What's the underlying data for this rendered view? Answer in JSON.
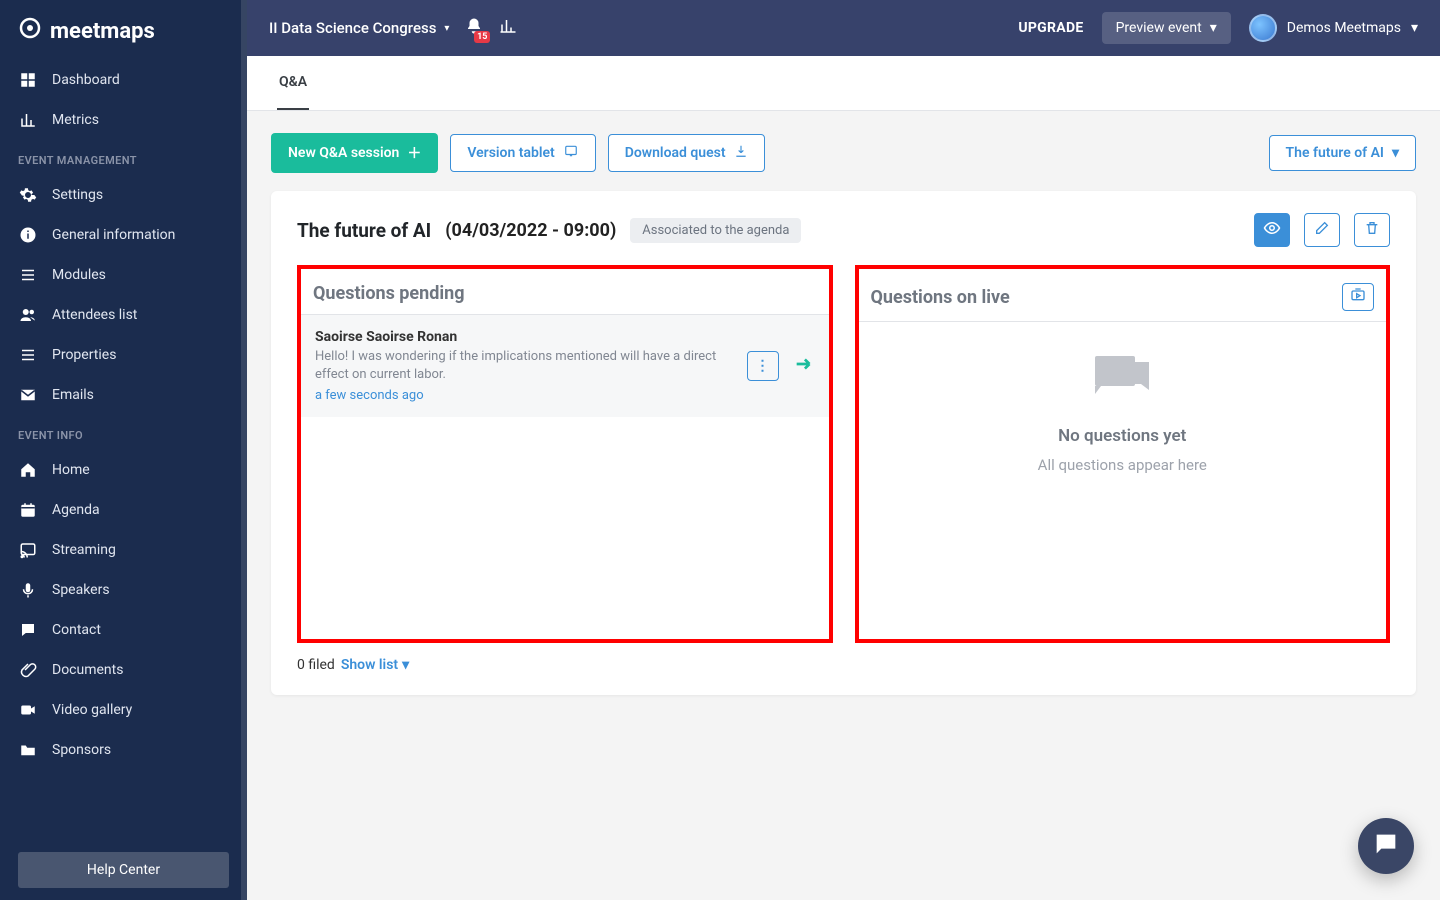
{
  "brand": "meetmaps",
  "topbar": {
    "event_name": "II Data Science Congress",
    "notif_count": "15",
    "upgrade": "UPGRADE",
    "preview": "Preview event",
    "user_name": "Demos Meetmaps"
  },
  "sidebar": {
    "top": [
      {
        "icon": "dashboard",
        "label": "Dashboard"
      },
      {
        "icon": "metrics",
        "label": "Metrics"
      }
    ],
    "sections": [
      {
        "title": "EVENT MANAGEMENT",
        "items": [
          {
            "icon": "gear",
            "label": "Settings"
          },
          {
            "icon": "info",
            "label": "General information"
          },
          {
            "icon": "list",
            "label": "Modules"
          },
          {
            "icon": "users",
            "label": "Attendees list"
          },
          {
            "icon": "list",
            "label": "Properties"
          },
          {
            "icon": "mail",
            "label": "Emails"
          }
        ]
      },
      {
        "title": "EVENT INFO",
        "items": [
          {
            "icon": "home",
            "label": "Home"
          },
          {
            "icon": "calendar",
            "label": "Agenda"
          },
          {
            "icon": "cast",
            "label": "Streaming"
          },
          {
            "icon": "mic",
            "label": "Speakers"
          },
          {
            "icon": "contact",
            "label": "Contact"
          },
          {
            "icon": "clip",
            "label": "Documents"
          },
          {
            "icon": "video",
            "label": "Video gallery"
          },
          {
            "icon": "folder",
            "label": "Sponsors"
          }
        ]
      }
    ],
    "footer": "Help Center"
  },
  "tabs": {
    "active": "Q&A"
  },
  "toolbar": {
    "new_session": "New Q&A session",
    "version_tablet": "Version tablet",
    "download": "Download quest",
    "filter": "The future of AI"
  },
  "session": {
    "title": "The future of AI",
    "datetime": "(04/03/2022 - 09:00)",
    "badge": "Associated to the agenda",
    "pending_header": "Questions pending",
    "live_header": "Questions on live",
    "empty_title": "No questions yet",
    "empty_sub": "All questions appear here",
    "questions": [
      {
        "author": "Saoirse Saoirse Ronan",
        "body": "Hello! I was wondering if the implications mentioned will have a direct effect on current labor.",
        "time": "a few seconds ago"
      }
    ],
    "filed_count": "0 filed",
    "show_list": "Show list"
  }
}
